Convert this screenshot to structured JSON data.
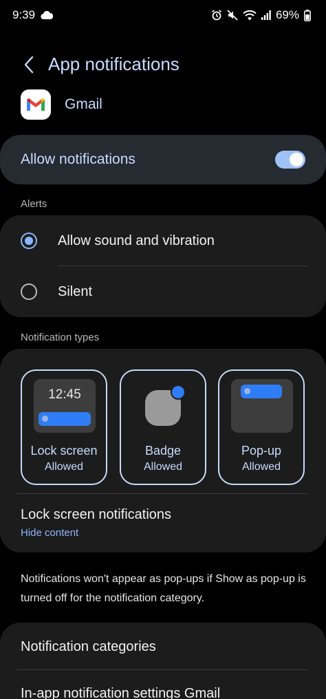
{
  "status_bar": {
    "time": "9:39",
    "battery": "69%"
  },
  "header": {
    "title": "App notifications"
  },
  "app": {
    "name": "Gmail"
  },
  "allow": {
    "label": "Allow notifications",
    "enabled": true
  },
  "alerts": {
    "section_label": "Alerts",
    "options": [
      {
        "label": "Allow sound and vibration",
        "selected": true
      },
      {
        "label": "Silent",
        "selected": false
      }
    ]
  },
  "types": {
    "section_label": "Notification types",
    "tiles": [
      {
        "title": "Lock screen",
        "status": "Allowed",
        "preview_time": "12:45"
      },
      {
        "title": "Badge",
        "status": "Allowed"
      },
      {
        "title": "Pop-up",
        "status": "Allowed"
      }
    ],
    "lock_screen_notifications": {
      "title": "Lock screen notifications",
      "value": "Hide content"
    }
  },
  "note": "Notifications won't appear as pop-ups if Show as pop-up is turned off for the notification category.",
  "list": {
    "categories": "Notification categories",
    "in_app": "In-app notification settings Gmail"
  },
  "colors": {
    "accent": "#c7dcff",
    "toggle_on": "#9ec2f5",
    "badge_blue": "#2f7df6"
  }
}
